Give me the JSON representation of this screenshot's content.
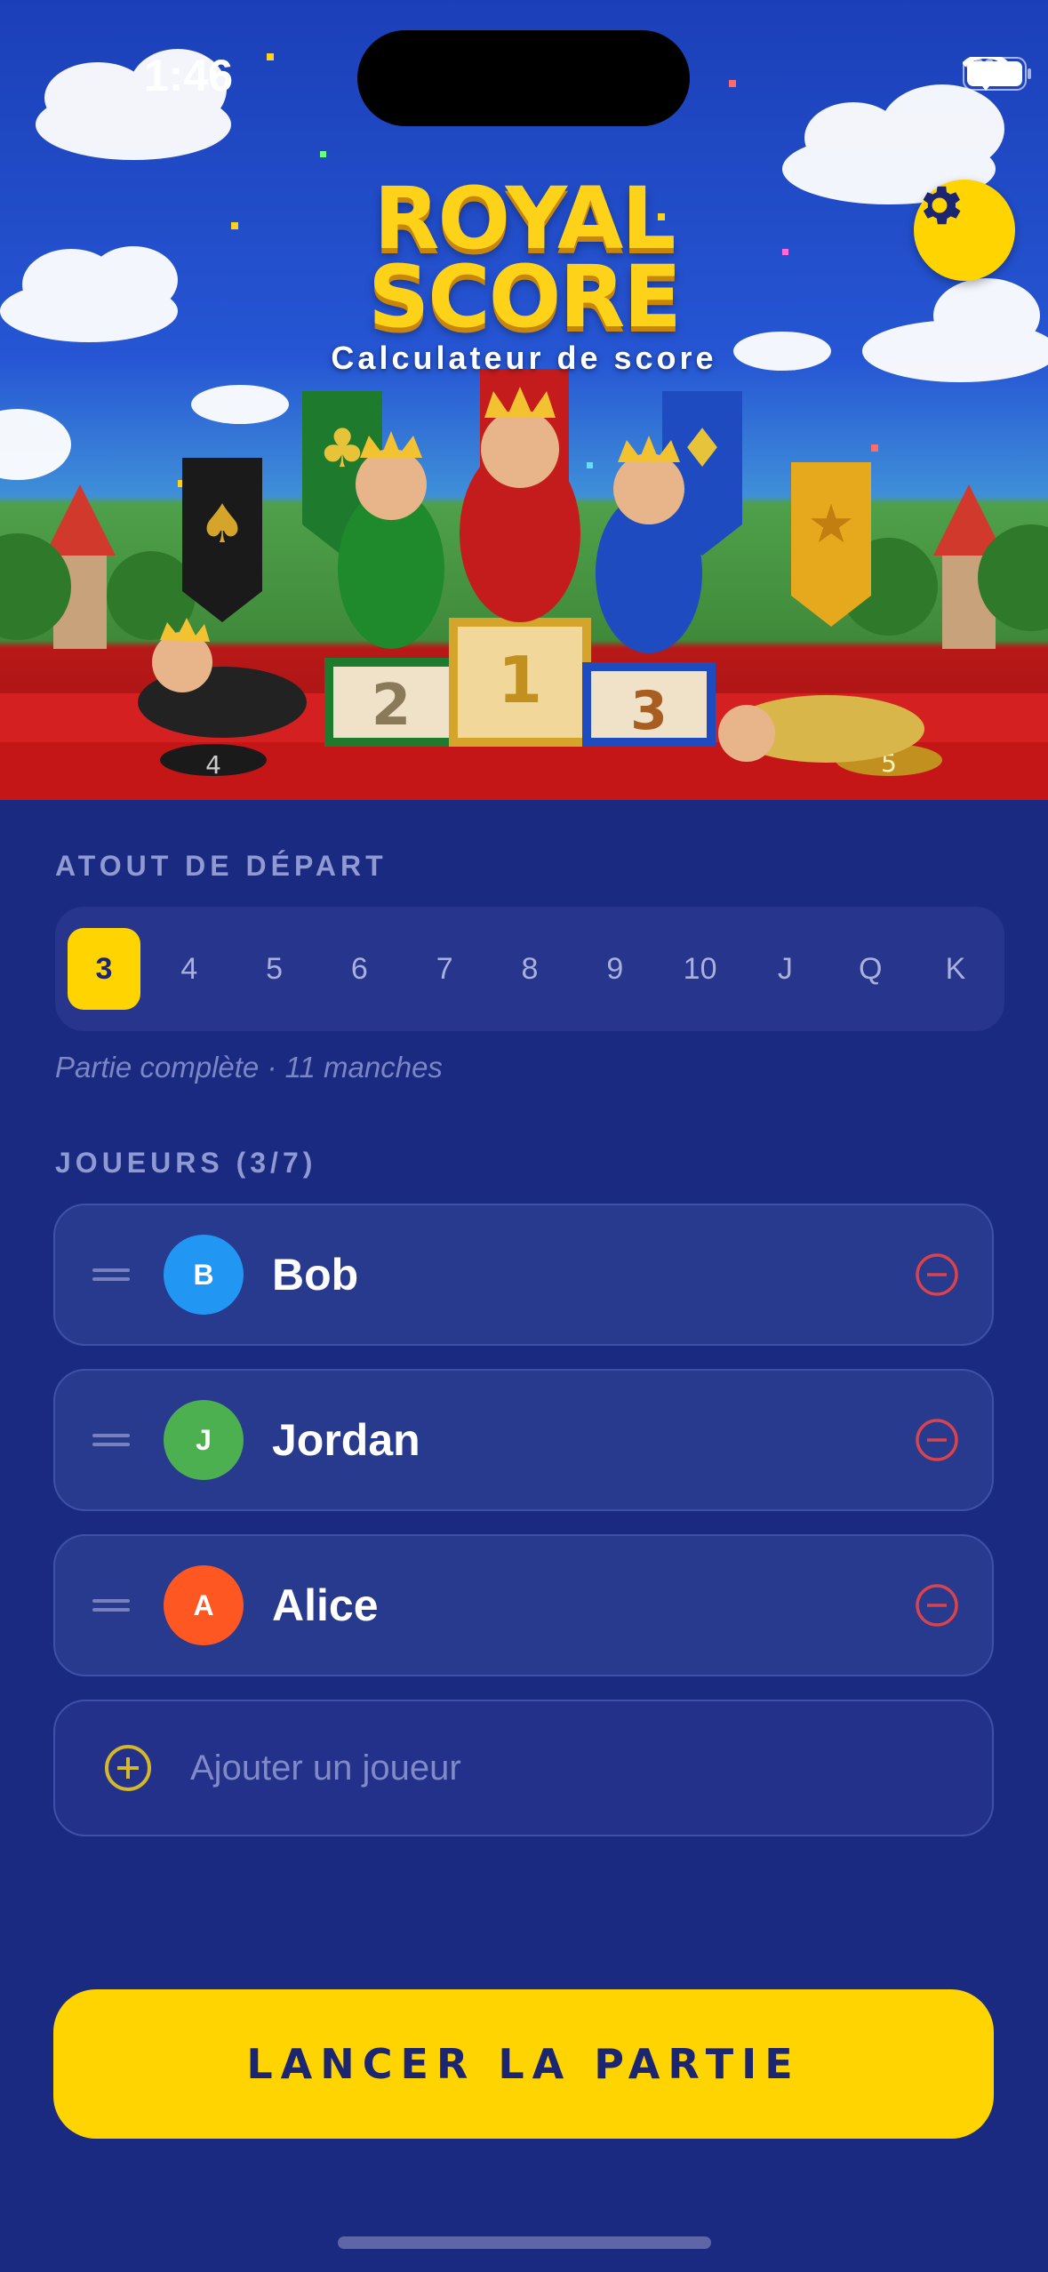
{
  "status_bar": {
    "time": "1:46"
  },
  "header": {
    "title_line1": "ROYAL",
    "title_line2": "SCORE",
    "subtitle": "Calculateur de score",
    "settings_icon": "gear-icon"
  },
  "trump": {
    "label": "ATOUT DE DÉPART",
    "options": [
      "3",
      "4",
      "5",
      "6",
      "7",
      "8",
      "9",
      "10",
      "J",
      "Q",
      "K"
    ],
    "selected": "3",
    "hint": "Partie complète · 11 manches"
  },
  "players": {
    "label": "JOUEURS (3/7)",
    "list": [
      {
        "initial": "B",
        "name": "Bob",
        "color": "#2196f3"
      },
      {
        "initial": "J",
        "name": "Jordan",
        "color": "#4caf50"
      },
      {
        "initial": "A",
        "name": "Alice",
        "color": "#ff5722"
      }
    ],
    "add_label": "Ajouter un joueur"
  },
  "colors": {
    "accent": "#ffd400",
    "background": "#1a2a80",
    "remove": "#d9434b"
  },
  "actions": {
    "start_label": "LANCER LA PARTIE"
  }
}
